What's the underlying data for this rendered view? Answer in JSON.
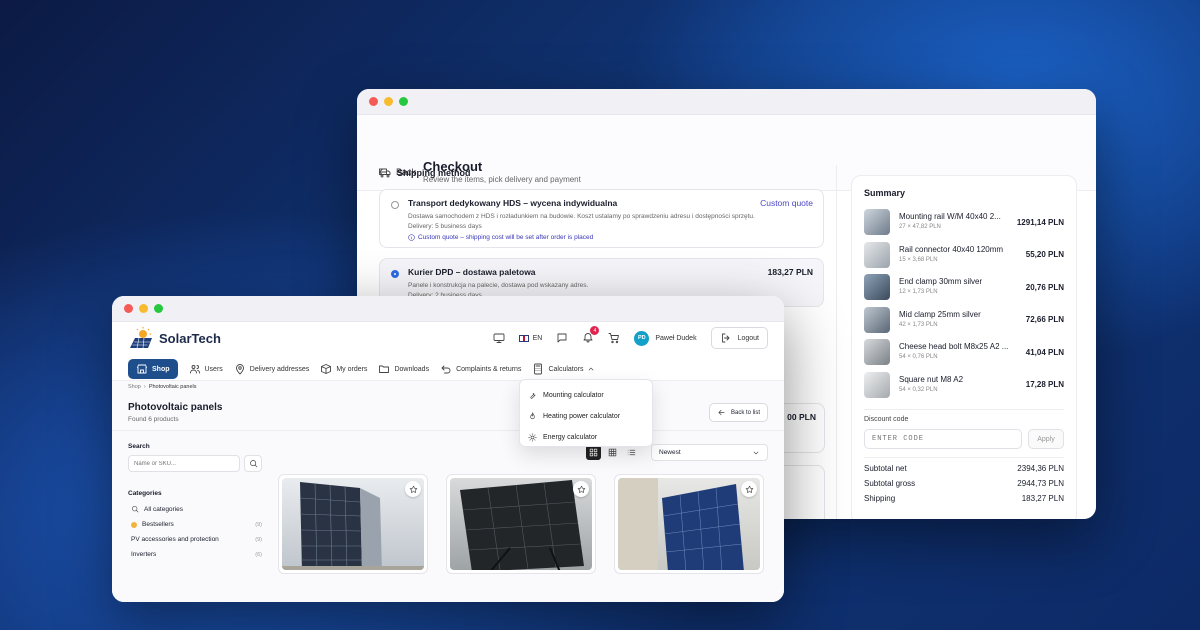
{
  "checkout": {
    "back_label": "Back",
    "title": "Checkout",
    "subtitle": "Review the items, pick delivery and payment",
    "shipping_heading": "Shipping method",
    "options": [
      {
        "title": "Transport dedykowany HDS – wycena indywidualna",
        "price": "Custom quote",
        "desc": "Dostawa samochodem z HDS i rozładunkiem na budowie. Koszt ustalamy po sprawdzeniu adresu i dostępności sprzętu.",
        "delivery": "Delivery: 5 business days",
        "note": "Custom quote – shipping cost will be set after order is placed",
        "selected": false
      },
      {
        "title": "Kurier DPD – dostawa paletowa",
        "price": "183,27 PLN",
        "desc": "Panele i konstrukcja na palecie, dostawa pod wskazany adres.",
        "delivery": "Delivery: 2 business days",
        "selected": true
      }
    ],
    "partial_price": "00 PLN",
    "summary": {
      "heading": "Summary",
      "items": [
        {
          "name": "Mounting rail W/M 40x40 2...",
          "qty": "27 × 47,82 PLN",
          "total": "1291,14 PLN"
        },
        {
          "name": "Rail connector 40x40 120mm",
          "qty": "15 × 3,68 PLN",
          "total": "55,20 PLN"
        },
        {
          "name": "End clamp 30mm silver",
          "qty": "12 × 1,73 PLN",
          "total": "20,76 PLN"
        },
        {
          "name": "Mid clamp 25mm silver",
          "qty": "42 × 1,73 PLN",
          "total": "72,66 PLN"
        },
        {
          "name": "Cheese head bolt M8x25 A2 ...",
          "qty": "54 × 0,76 PLN",
          "total": "41,04 PLN"
        },
        {
          "name": "Square nut M8 A2",
          "qty": "54 × 0,32 PLN",
          "total": "17,28 PLN"
        }
      ],
      "discount_label": "Discount code",
      "discount_placeholder": "ENTER CODE",
      "apply_label": "Apply",
      "subtotal_net_label": "Subtotal net",
      "subtotal_net": "2394,36 PLN",
      "subtotal_gross_label": "Subtotal gross",
      "subtotal_gross": "2944,73 PLN",
      "shipping_label": "Shipping",
      "shipping": "183,27 PLN"
    }
  },
  "shop": {
    "brand": "SolarTech",
    "lang": "EN",
    "notifications": "4",
    "user_initials": "PD",
    "user_name": "Paweł Dudek",
    "logout": "Logout",
    "nav": {
      "shop": "Shop",
      "users": "Users",
      "delivery": "Delivery addresses",
      "orders": "My orders",
      "downloads": "Downloads",
      "complaints": "Complaints & returns",
      "calculators": "Calculators"
    },
    "calculators_menu": [
      "Mounting calculator",
      "Heating power calculator",
      "Energy calculator"
    ],
    "breadcrumb": [
      "Shop",
      "Photovoltaic panels"
    ],
    "page_title": "Photovoltaic panels",
    "found": "Found 6 products",
    "back_to_list": "Back to list",
    "search_label": "Search",
    "search_placeholder": "Name or SKU...",
    "categories_label": "Categories",
    "categories": [
      {
        "name": "All categories",
        "count": ""
      },
      {
        "name": "Bestsellers",
        "count": "(9)"
      },
      {
        "name": "PV accessories and protection",
        "count": "(9)"
      },
      {
        "name": "Inverters",
        "count": "(6)"
      }
    ],
    "sort": "Newest"
  },
  "colors": {
    "accent": "#1f4e8c",
    "badge": "#e0244f",
    "link": "#4d46c6"
  }
}
